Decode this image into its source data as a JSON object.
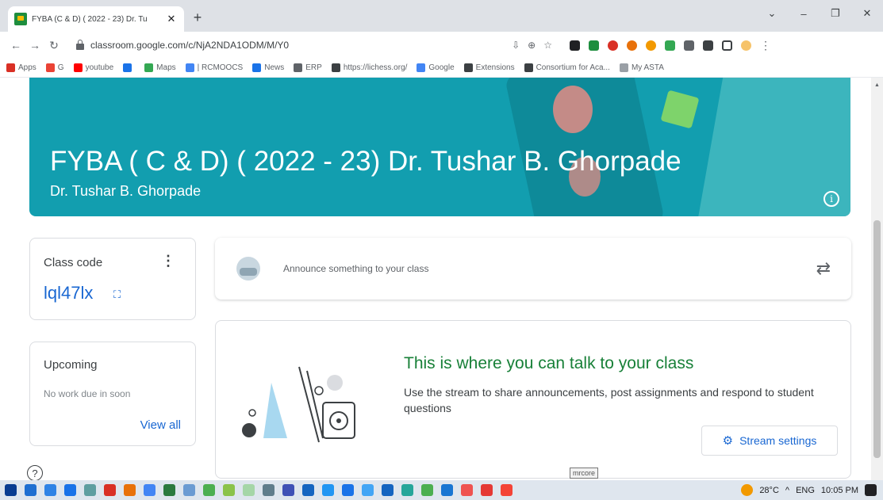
{
  "browser": {
    "tab_title": "FYBA (C & D) ( 2022 - 23) Dr. Tu",
    "tab_close": "✕",
    "new_tab": "+",
    "window_controls": [
      "⌄",
      "–",
      "❐",
      "✕"
    ],
    "url": "classroom.google.com/c/NjA2NDA1ODM/M/Y0",
    "nav": {
      "back": "←",
      "forward": "→",
      "reload": "↻"
    },
    "omnibox_icons": [
      "⇩",
      "⊕",
      "☆"
    ]
  },
  "bookmarks": [
    {
      "label": "Apps",
      "icon": "apps-icon",
      "color": "#d93025"
    },
    {
      "label": "G",
      "icon": "google-icon",
      "color": "#ea4335"
    },
    {
      "label": "youtube",
      "icon": "youtube-icon",
      "color": "#ff0000"
    },
    {
      "label": "",
      "icon": "bookmark-icon",
      "color": "#1a73e8"
    },
    {
      "label": "Maps",
      "icon": "maps-icon",
      "color": "#34a853"
    },
    {
      "label": "| RCMOOCS",
      "icon": "globe-icon",
      "color": "#4285f4"
    },
    {
      "label": "News",
      "icon": "news-icon",
      "color": "#1a73e8"
    },
    {
      "label": "ERP",
      "icon": "erp-icon",
      "color": "#5f6368"
    },
    {
      "label": "https://lichess.org/",
      "icon": "lichess-icon",
      "color": "#3c4043"
    },
    {
      "label": "Google",
      "icon": "google-icon",
      "color": "#4285f4"
    },
    {
      "label": "Extensions",
      "icon": "puzzle-icon",
      "color": "#3c4043"
    },
    {
      "label": "Consortium for Aca...",
      "icon": "globe-icon",
      "color": "#3c4043"
    },
    {
      "label": "My ASTA",
      "icon": "page-icon",
      "color": "#9aa0a6"
    }
  ],
  "banner": {
    "title": "FYBA ( C & D) ( 2022 - 23) Dr. Tushar B. Ghorpade",
    "subtitle": "Dr. Tushar B. Ghorpade",
    "info_icon": "i",
    "color": "#129eaf"
  },
  "class_code": {
    "label": "Class code",
    "menu": "⋮",
    "value": "lql47lx",
    "expand_icon": "⛶"
  },
  "upcoming": {
    "label": "Upcoming",
    "text": "No work due in soon",
    "link": "View all"
  },
  "announce": {
    "placeholder": "Announce something to your class",
    "repost_icon": "⇄"
  },
  "talk": {
    "title": "This is where you can talk to your class",
    "description": "Use the stream to share announcements, post assignments and respond to student questions",
    "button": "Stream settings",
    "gear_icon": "⚙"
  },
  "help_icon": "?",
  "taskbar": {
    "tooltip": "mrcore",
    "weather": "28°C",
    "lang": "ENG",
    "time": "10:05 PM",
    "caret": "^",
    "icons": [
      "#1f6fd1",
      "#2f83e5",
      "#1a73e8",
      "#5f9ea0",
      "#d93025",
      "#e8710a",
      "#4285f4",
      "#2b7a3e",
      "#6b9bd2",
      "#4caf50",
      "#8bc34a",
      "#a5d6a7",
      "#607d8b",
      "#3f51b5",
      "#1565c0",
      "#2196f3",
      "#1a73e8",
      "#42a5f5",
      "#1565c0",
      "#26a69a",
      "#4caf50",
      "#1976d2",
      "#ef5350",
      "#e53935",
      "#f44336"
    ]
  }
}
